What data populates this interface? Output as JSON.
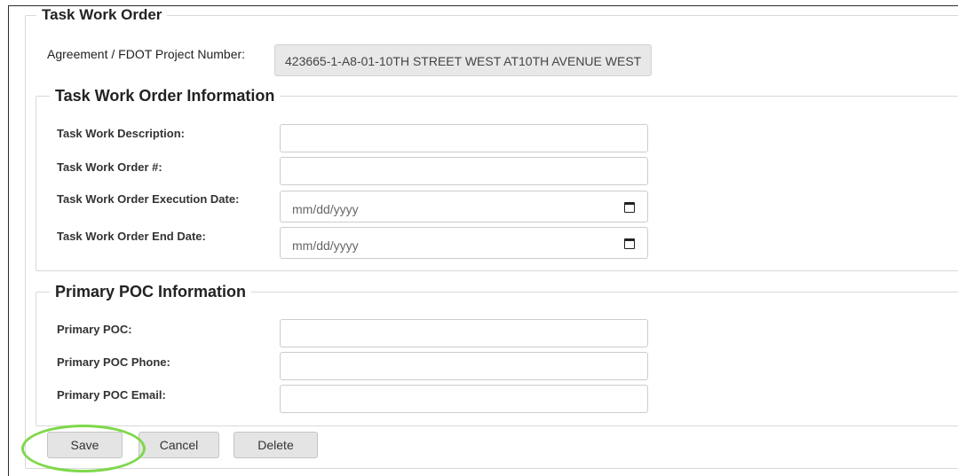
{
  "form": {
    "title": "Task Work Order",
    "agreement_label": "Agreement / FDOT Project Number:",
    "agreement_value": "423665-1-A8-01-10TH STREET WEST AT10TH AVENUE WEST"
  },
  "task_info": {
    "title": "Task Work Order Information",
    "description_label": "Task Work Description:",
    "description_value": "",
    "order_number_label": "Task Work Order #:",
    "order_number_value": "",
    "execution_date_label": "Task Work Order Execution Date:",
    "execution_date_placeholder": "mm/dd/yyyy",
    "end_date_label": "Task Work Order End Date:",
    "end_date_placeholder": "mm/dd/yyyy"
  },
  "poc_info": {
    "title": "Primary POC Information",
    "poc_label": "Primary POC:",
    "poc_value": "",
    "phone_label": "Primary POC Phone:",
    "phone_value": "",
    "email_label": "Primary POC Email:",
    "email_value": ""
  },
  "buttons": {
    "save": "Save",
    "cancel": "Cancel",
    "delete": "Delete"
  },
  "colors": {
    "highlight": "#7dd84a",
    "readonly_bg": "#e8e8e8"
  },
  "icons": {
    "date_picker": "calendar-icon"
  }
}
